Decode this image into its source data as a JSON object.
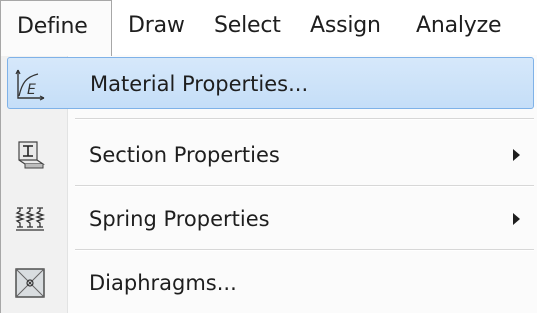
{
  "menubar": {
    "items": [
      {
        "label": "Define",
        "active": true
      },
      {
        "label": "Draw"
      },
      {
        "label": "Select"
      },
      {
        "label": "Assign"
      },
      {
        "label": "Analyze"
      }
    ]
  },
  "dropdown": {
    "items": [
      {
        "label": "Material Properties...",
        "icon": "material-properties-icon",
        "submenu": false,
        "highlighted": true
      },
      {
        "label": "Section Properties",
        "icon": "section-properties-icon",
        "submenu": true
      },
      {
        "label": "Spring Properties",
        "icon": "spring-properties-icon",
        "submenu": true
      },
      {
        "label": "Diaphragms...",
        "icon": "diaphragms-icon",
        "submenu": false
      }
    ]
  },
  "colors": {
    "highlight_fill": "#cde4f9",
    "highlight_border": "#7fb2e8",
    "menu_background": "#fbfbfb",
    "icon_gutter": "#f1f1f1"
  }
}
